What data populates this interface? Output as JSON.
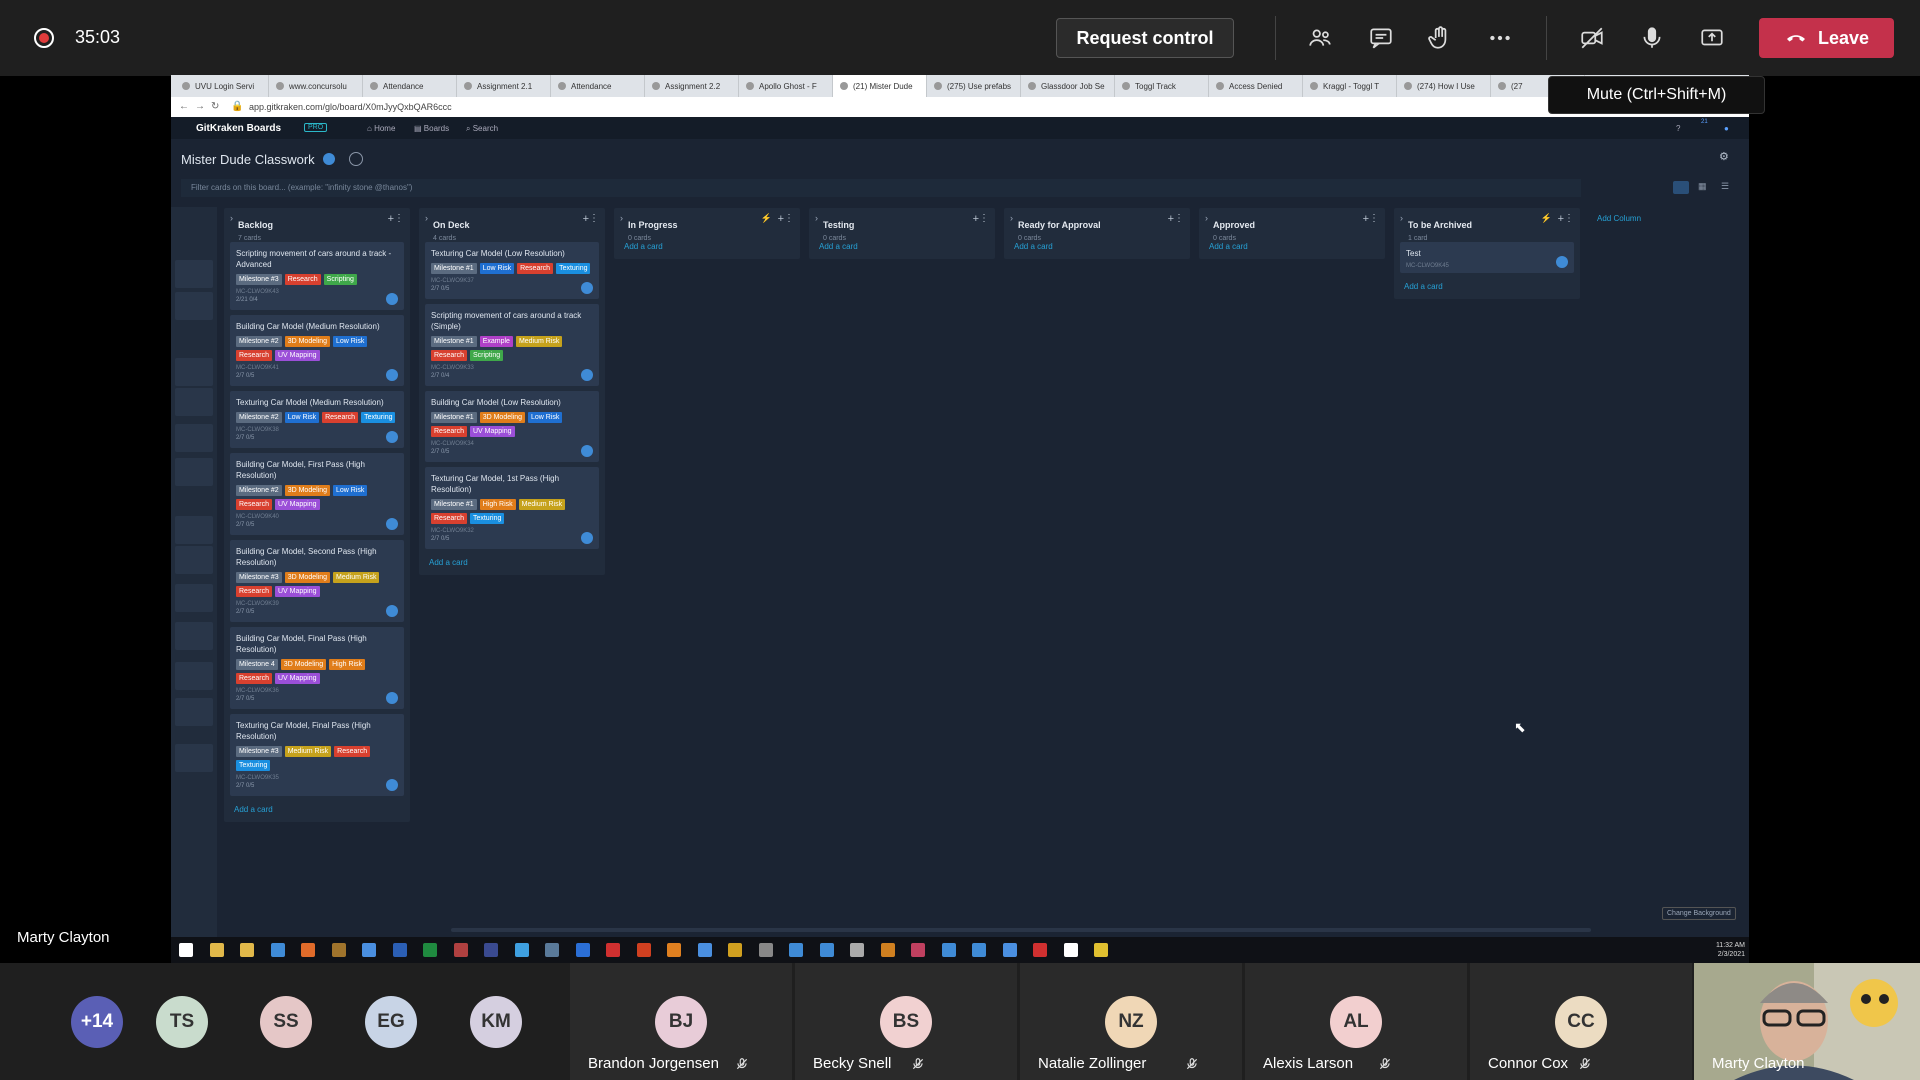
{
  "topbar": {
    "timer": "35:03",
    "request_control_label": "Request control",
    "leave_label": "Leave",
    "mute_tooltip": "Mute (Ctrl+Shift+M)"
  },
  "browser": {
    "tabs": [
      "UVU Login Servi",
      "www.concursolu",
      "Attendance",
      "Assignment 2.1",
      "Attendance",
      "Assignment 2.2",
      "Apollo Ghost - F",
      "(21) Mister Dude",
      "(275) Use prefabs",
      "Glassdoor Job Se",
      "Toggl Track",
      "Access Denied",
      "Kraggl - Toggl T",
      "(274) How I Use",
      "(27"
    ],
    "url": "app.gitkraken.com/glo/board/X0mJyyQxbQAR6ccc"
  },
  "gitkraken": {
    "logo": "GitKraken Boards",
    "pro_badge": "PRO",
    "nav_home": "Home",
    "nav_boards": "Boards",
    "nav_search": "Search",
    "board_title": "Mister Dude Classwork",
    "filter_placeholder": "Filter cards on this board... (example: \"infinity stone @thanos\")",
    "add_column": "Add Column",
    "change_background": "Change Background",
    "add_card": "Add a card",
    "notif_count": "21"
  },
  "columns": [
    {
      "title": "Backlog",
      "count": "7 cards",
      "cards": [
        {
          "title": "Scripting movement of cars around a track - Advanced",
          "labels": [
            "Milestone #3",
            "Research",
            "Scripting"
          ],
          "id": "MC-CLWO9K43",
          "foot": "2/21   0/4"
        },
        {
          "title": "Building Car Model (Medium Resolution)",
          "labels": [
            "Milestone #2",
            "3D Modeling",
            "Low Risk",
            "Research",
            "UV Mapping"
          ],
          "id": "MC-CLWO9K41",
          "foot": "2/7   0/5"
        },
        {
          "title": "Texturing Car Model (Medium Resolution)",
          "labels": [
            "Milestone #2",
            "Low Risk",
            "Research",
            "Texturing"
          ],
          "id": "MC-CLWO9K38",
          "foot": "2/7   0/5"
        },
        {
          "title": "Building Car Model, First Pass (High Resolution)",
          "labels": [
            "Milestone #2",
            "3D Modeling",
            "Low Risk",
            "Research",
            "UV Mapping"
          ],
          "id": "MC-CLWO9K40",
          "foot": "2/7   0/5"
        },
        {
          "title": "Building Car Model, Second Pass (High Resolution)",
          "labels": [
            "Milestone #3",
            "3D Modeling",
            "Medium Risk",
            "Research",
            "UV Mapping"
          ],
          "id": "MC-CLWO9K39",
          "foot": "2/7   0/5"
        },
        {
          "title": "Building Car Model, Final Pass (High Resolution)",
          "labels": [
            "Milestone 4",
            "3D Modeling",
            "High Risk",
            "Research",
            "UV Mapping"
          ],
          "id": "MC-CLWO9K36",
          "foot": "2/7   0/5"
        },
        {
          "title": "Texturing Car Model, Final Pass (High Resolution)",
          "labels": [
            "Milestone #3",
            "Medium Risk",
            "Research",
            "Texturing"
          ],
          "id": "MC-CLWO9K35",
          "foot": "2/7   0/5"
        }
      ]
    },
    {
      "title": "On Deck",
      "count": "4 cards",
      "cards": [
        {
          "title": "Texturing Car Model (Low Resolution)",
          "labels": [
            "Milestone #1",
            "Low Risk",
            "Research",
            "Texturing"
          ],
          "id": "MC-CLWO9K37",
          "foot": "2/7   0/5"
        },
        {
          "title": "Scripting movement of cars around a track (Simple)",
          "labels": [
            "Milestone #1",
            "Example",
            "Medium Risk",
            "Research",
            "Scripting"
          ],
          "id": "MC-CLWO9K33",
          "foot": "2/7   0/4"
        },
        {
          "title": "Building Car Model (Low Resolution)",
          "labels": [
            "Milestone #1",
            "3D Modeling",
            "Low Risk",
            "Research",
            "UV Mapping"
          ],
          "id": "MC-CLWO9K34",
          "foot": "2/7   0/5"
        },
        {
          "title": "Texturing Car Model, 1st Pass (High Resolution)",
          "labels": [
            "Milestone #1",
            "High Risk",
            "Medium Risk",
            "Research",
            "Texturing"
          ],
          "id": "MC-CLWO9K32",
          "foot": "2/7   0/5"
        }
      ]
    },
    {
      "title": "In Progress",
      "count": "0 cards",
      "cards": []
    },
    {
      "title": "Testing",
      "count": "0 cards",
      "cards": []
    },
    {
      "title": "Ready for Approval",
      "count": "0 cards",
      "cards": []
    },
    {
      "title": "Approved",
      "count": "0 cards",
      "cards": []
    },
    {
      "title": "To be Archived",
      "count": "1 card",
      "cards": [
        {
          "title": "Test",
          "labels": [],
          "id": "MC-CLWO9K45",
          "foot": ""
        }
      ]
    }
  ],
  "label_colors": {
    "Milestone #1": "#5b6b80",
    "Milestone #2": "#5b6b80",
    "Milestone #3": "#5b6b80",
    "Milestone 4": "#5b6b80",
    "Research": "#d8402f",
    "Scripting": "#3fa84a",
    "3D Modeling": "#e07d1a",
    "Low Risk": "#1f6fd1",
    "UV Mapping": "#9b4fd8",
    "Texturing": "#1a8fe0",
    "Medium Risk": "#c6a21c",
    "High Risk": "#e07d1a",
    "Example": "#b040c8"
  },
  "taskbar": {
    "time": "11:32 AM",
    "date": "2/3/2021"
  },
  "presenter": {
    "name": "Marty Clayton"
  },
  "participants": {
    "overflow": "+14",
    "initials_only": [
      {
        "initials": "TS",
        "color": "#c9dccd"
      },
      {
        "initials": "SS",
        "color": "#e5c7c7"
      },
      {
        "initials": "EG",
        "color": "#c8d4e6"
      },
      {
        "initials": "KM",
        "color": "#d5cfe0"
      }
    ],
    "named": [
      {
        "initials": "BJ",
        "name": "Brandon Jorgensen",
        "color": "#e8ccd8"
      },
      {
        "initials": "BS",
        "name": "Becky Snell",
        "color": "#f1d1d1"
      },
      {
        "initials": "NZ",
        "name": "Natalie Zollinger",
        "color": "#f0d7b6"
      },
      {
        "initials": "AL",
        "name": "Alexis Larson",
        "color": "#f2cfcf"
      },
      {
        "initials": "CC",
        "name": "Connor Cox",
        "color": "#ecdcc2"
      }
    ],
    "self_name": "Marty Clayton"
  }
}
